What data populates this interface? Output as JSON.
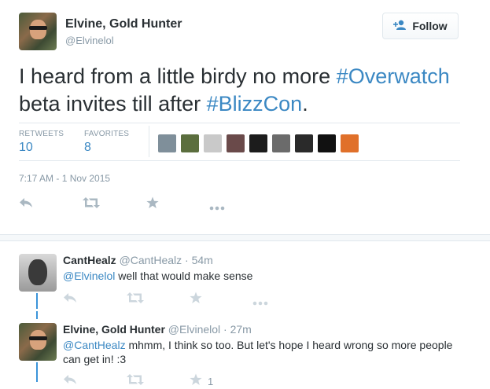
{
  "tweet": {
    "author_name": "Elvine, Gold Hunter",
    "author_handle": "@Elvinelol",
    "text_part1": "I heard from a little birdy no more ",
    "hashtag1": "#Overwatch",
    "text_part2": " beta invites till after ",
    "hashtag2": "#BlizzCon",
    "text_part3": ".",
    "retweets_label": "RETWEETS",
    "retweets_count": "10",
    "favorites_label": "FAVORITES",
    "favorites_count": "8",
    "timestamp": "7:17 AM - 1 Nov 2015"
  },
  "follow_button": {
    "label": "Follow",
    "icon": "follow-person-plus-icon"
  },
  "favoriters": [
    {
      "name": "favoriter-1",
      "color": "#7f8f9a"
    },
    {
      "name": "favoriter-2",
      "color": "#5b6e3e"
    },
    {
      "name": "favoriter-3",
      "color": "#c9c9c9"
    },
    {
      "name": "favoriter-4",
      "color": "#6a4a4a"
    },
    {
      "name": "favoriter-5",
      "color": "#1c1c1c"
    },
    {
      "name": "favoriter-6",
      "color": "#6b6b6b"
    },
    {
      "name": "favoriter-7",
      "color": "#2a2a2a"
    },
    {
      "name": "favoriter-8",
      "color": "#111111"
    },
    {
      "name": "favoriter-9",
      "color": "#e0702a"
    }
  ],
  "actions": {
    "reply_icon": "reply-icon",
    "retweet_icon": "retweet-icon",
    "favorite_icon": "favorite-star-icon",
    "more_icon": "more-dots-icon"
  },
  "replies": [
    {
      "author_name": "CantHealz",
      "author_handle": "@CantHealz",
      "time": "54m",
      "mention": "@Elvinelol",
      "text": " well that would make sense"
    },
    {
      "author_name": "Elvine, Gold Hunter",
      "author_handle": "@Elvinelol",
      "time": "27m",
      "mention": "@CantHealz",
      "text_line1": " mhmm, I think so too. But let's hope I heard wrong so more people",
      "text_line2": "can get in! :3",
      "favorite_count": "1"
    }
  ]
}
